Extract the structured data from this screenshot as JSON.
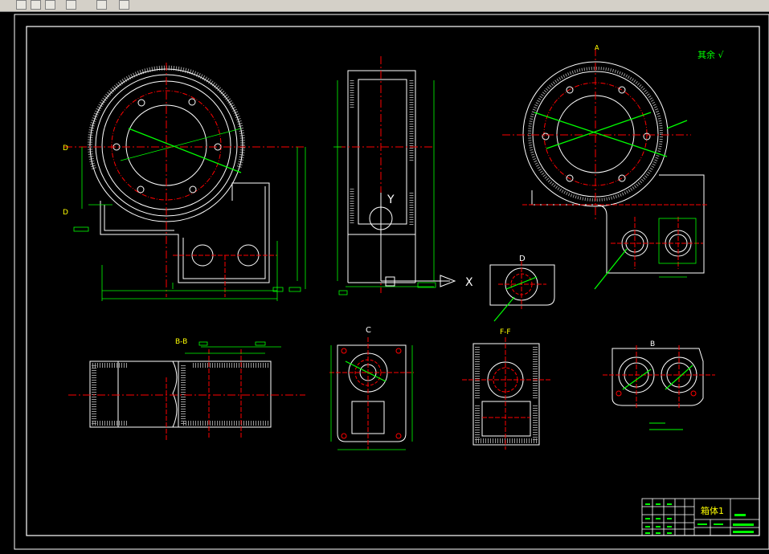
{
  "toolbar": {
    "buttons": [
      "draw-tool",
      "save-tool",
      "window-tool",
      "star-tool",
      "separator-tool",
      "properties-tool",
      "paint-tool"
    ]
  },
  "drawing": {
    "view_labels": {
      "section_b_b": "B-B",
      "view_c": "C",
      "view_d": "D",
      "section_f_f": "F-F",
      "view_b": "B",
      "view_a": "A",
      "axis_x": "X",
      "axis_y": "Y",
      "marker_d_top": "D",
      "marker_d_bottom": "D"
    },
    "surface_note": "其余 √",
    "title_block": {
      "part_name": "箱体1"
    }
  },
  "colors": {
    "background": "#000000",
    "outline": "#ffffff",
    "dimension": "#00ff00",
    "centerline": "#ff0000",
    "hatch": "#ffffff",
    "marker": "#ffff00"
  }
}
